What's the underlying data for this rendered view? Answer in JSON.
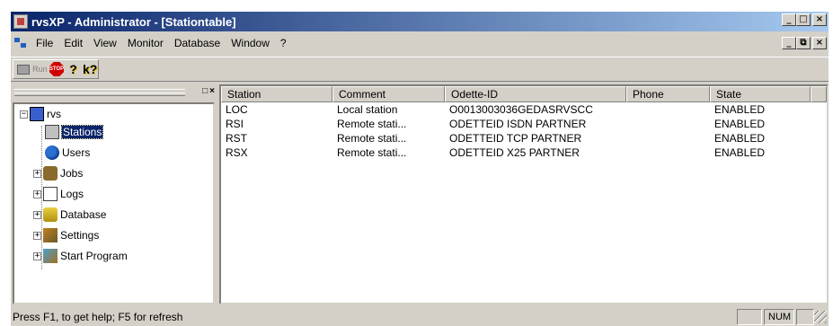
{
  "window": {
    "title": "rvsXP - Administrator - [Stationtable]",
    "controls": [
      "_",
      "□",
      "×"
    ],
    "mdi_controls": [
      "_",
      "⧉",
      "×"
    ]
  },
  "menubar": {
    "items": [
      "File",
      "Edit",
      "View",
      "Monitor",
      "Database",
      "Window",
      "?"
    ]
  },
  "toolbar": {
    "run_label": "Run",
    "stop_label": "STOP",
    "help_label": "?",
    "context_help_label": "k?"
  },
  "tree": {
    "root": "rvs",
    "items": [
      "Stations",
      "Users",
      "Jobs",
      "Logs",
      "Database",
      "Settings",
      "Start Program"
    ],
    "selected": "Stations",
    "pane_controls": [
      "□",
      "×"
    ]
  },
  "table": {
    "columns": [
      "Station",
      "Comment",
      "Odette-ID",
      "Phone",
      "State"
    ],
    "rows": [
      {
        "station": "LOC",
        "comment": "Local station",
        "odette": "O0013003036GEDASRVSCC",
        "phone": "",
        "state": "ENABLED"
      },
      {
        "station": "RSI",
        "comment": "Remote stati...",
        "odette": "ODETTEID ISDN PARTNER",
        "phone": "",
        "state": "ENABLED"
      },
      {
        "station": "RST",
        "comment": "Remote stati...",
        "odette": "ODETTEID TCP PARTNER",
        "phone": "",
        "state": "ENABLED"
      },
      {
        "station": "RSX",
        "comment": "Remote stati...",
        "odette": "ODETTEID X25 PARTNER",
        "phone": "",
        "state": "ENABLED"
      }
    ]
  },
  "statusbar": {
    "help_text": "Press F1, to get help; F5 for refresh",
    "num_indicator": "NUM"
  }
}
